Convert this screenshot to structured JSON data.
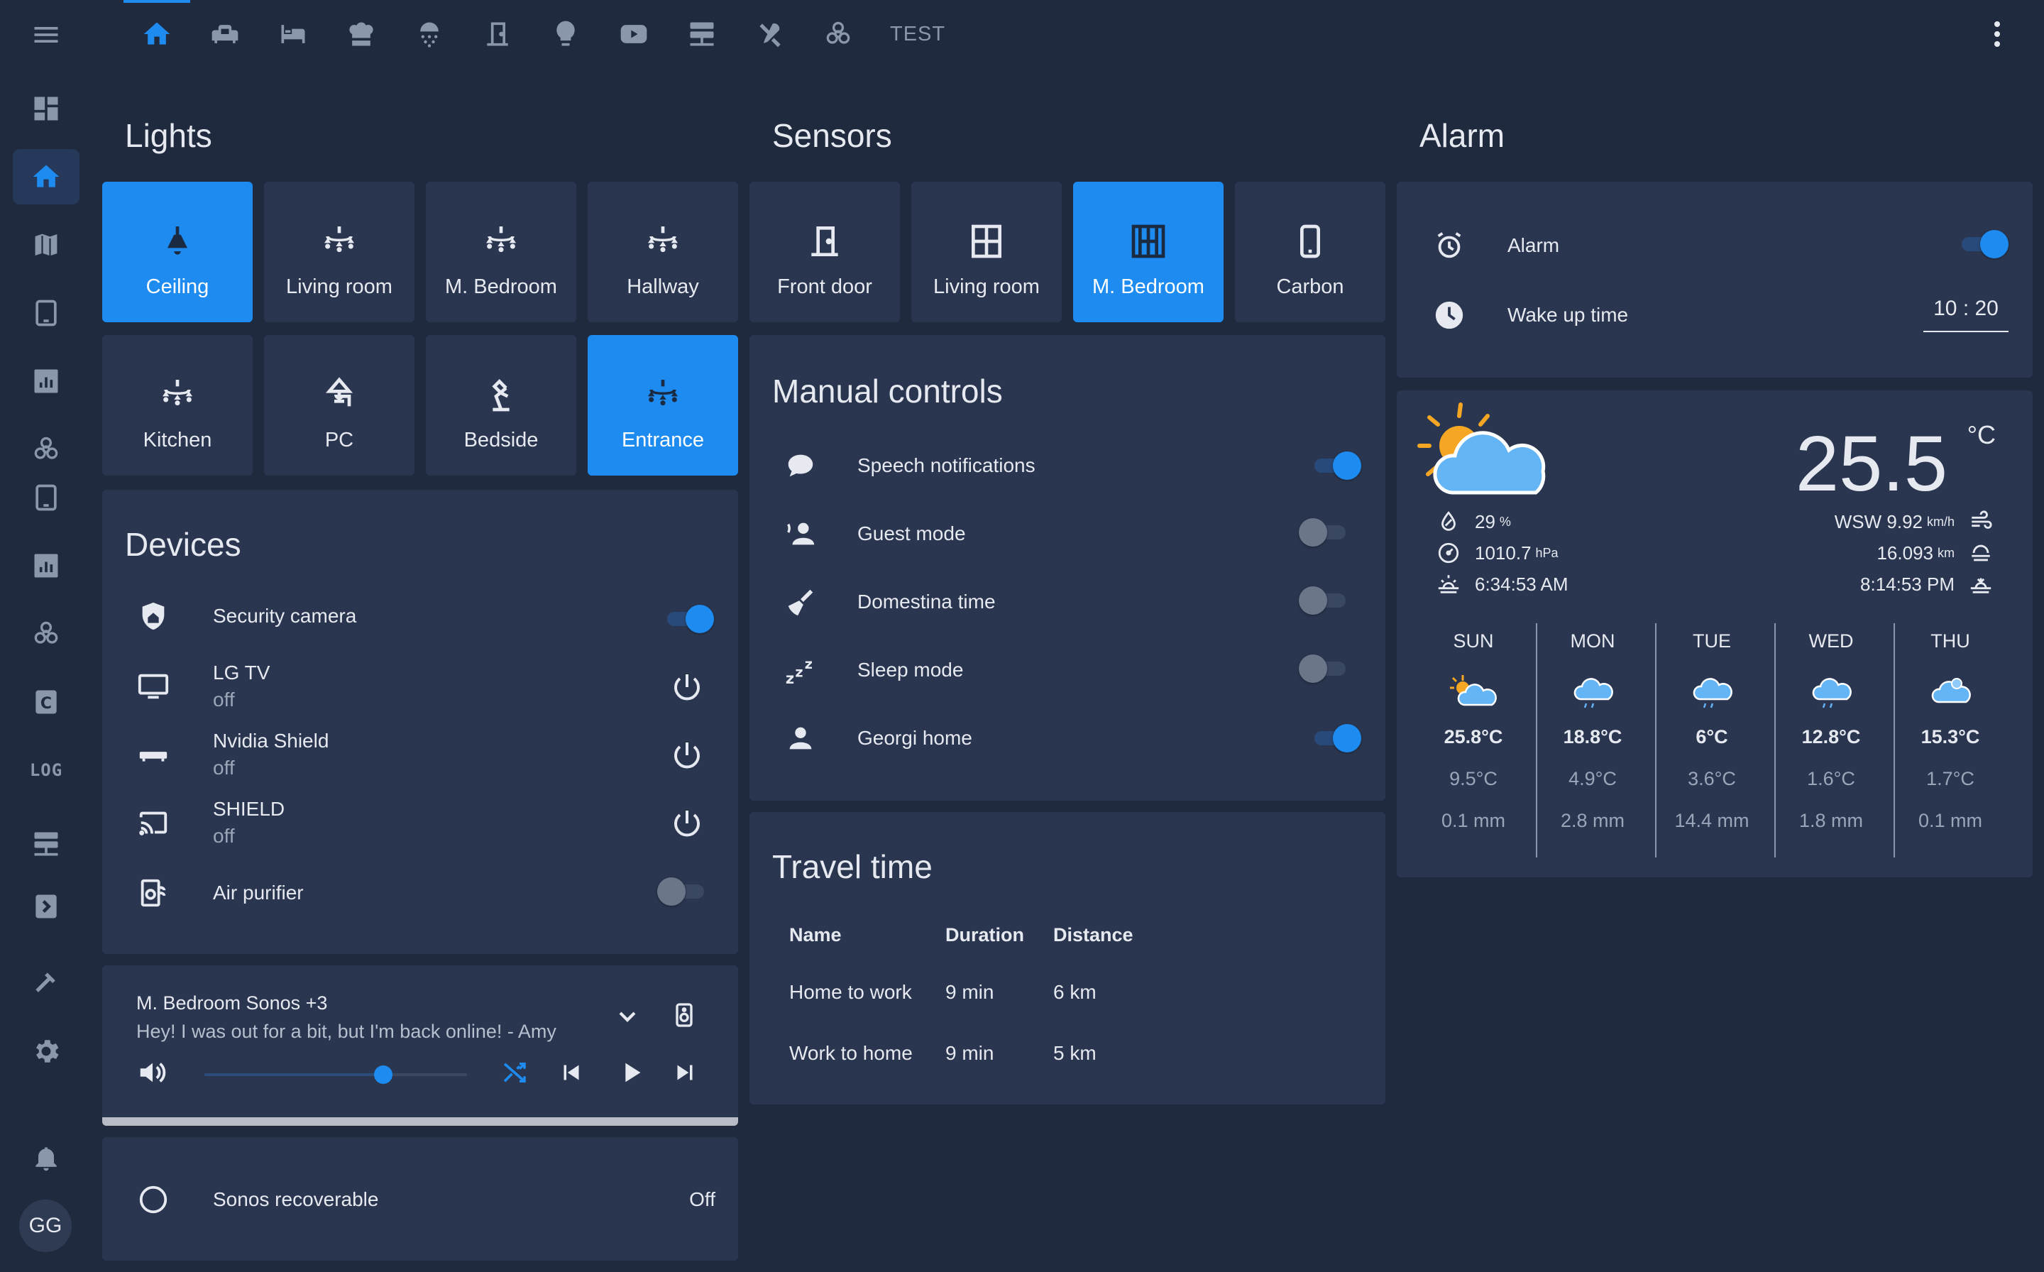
{
  "topbar": {
    "tabs": [
      {
        "icon": "home-icon",
        "active": true
      },
      {
        "icon": "sofa-icon"
      },
      {
        "icon": "bed-icon"
      },
      {
        "icon": "chef-hat-icon"
      },
      {
        "icon": "shower-icon"
      },
      {
        "icon": "door-icon"
      },
      {
        "icon": "lightbulb-icon"
      },
      {
        "icon": "youtube-icon"
      },
      {
        "icon": "server-icon"
      },
      {
        "icon": "tools-icon"
      },
      {
        "icon": "biohazard-icon"
      }
    ],
    "test_label": "TEST"
  },
  "sidebar": {
    "log_label": "LOG",
    "c_label": "C",
    "avatar_initials": "GG"
  },
  "lights": {
    "title": "Lights",
    "tiles": [
      {
        "label": "Ceiling",
        "on": true
      },
      {
        "label": "Living room",
        "on": false
      },
      {
        "label": "M. Bedroom",
        "on": false
      },
      {
        "label": "Hallway",
        "on": false
      },
      {
        "label": "Kitchen",
        "on": false
      },
      {
        "label": "PC",
        "on": false
      },
      {
        "label": "Bedside",
        "on": false
      },
      {
        "label": "Entrance",
        "on": true
      }
    ]
  },
  "sensors": {
    "title": "Sensors",
    "tiles": [
      {
        "label": "Front door",
        "on": false
      },
      {
        "label": "Living room",
        "on": false
      },
      {
        "label": "M. Bedroom",
        "on": true
      },
      {
        "label": "Carbon",
        "on": false
      }
    ]
  },
  "alarm": {
    "title": "Alarm",
    "alarm_label": "Alarm",
    "alarm_on": true,
    "wake_label": "Wake up time",
    "wake_time": "10 : 20"
  },
  "devices": {
    "title": "Devices",
    "items": [
      {
        "label": "Security camera",
        "state": "",
        "control": "toggle-on"
      },
      {
        "label": "LG TV",
        "state": "off",
        "control": "power"
      },
      {
        "label": "Nvidia Shield",
        "state": "off",
        "control": "power"
      },
      {
        "label": "SHIELD",
        "state": "off",
        "control": "power"
      },
      {
        "label": "Air purifier",
        "state": "",
        "control": "toggle-off"
      }
    ]
  },
  "manual": {
    "title": "Manual controls",
    "items": [
      {
        "label": "Speech notifications",
        "on": true
      },
      {
        "label": "Guest mode",
        "on": false
      },
      {
        "label": "Domestina time",
        "on": false
      },
      {
        "label": "Sleep mode",
        "on": false
      },
      {
        "label": "Georgi home",
        "on": true
      }
    ]
  },
  "weather": {
    "temp": "25.5",
    "unit": "°C",
    "humidity": "29",
    "humidity_unit": "%",
    "pressure": "1010.7",
    "pressure_unit": "hPa",
    "sunrise": "6:34:53 AM",
    "wind": "WSW 9.92",
    "wind_unit": "km/h",
    "visibility": "16.093",
    "visibility_unit": "km",
    "sunset": "8:14:53 PM",
    "forecast": [
      {
        "day": "SUN",
        "hi": "25.8°C",
        "lo": "9.5°C",
        "prec": "0.1 mm"
      },
      {
        "day": "MON",
        "hi": "18.8°C",
        "lo": "4.9°C",
        "prec": "2.8 mm"
      },
      {
        "day": "TUE",
        "hi": "6°C",
        "lo": "3.6°C",
        "prec": "14.4 mm"
      },
      {
        "day": "WED",
        "hi": "12.8°C",
        "lo": "1.6°C",
        "prec": "1.8 mm"
      },
      {
        "day": "THU",
        "hi": "15.3°C",
        "lo": "1.7°C",
        "prec": "0.1 mm"
      }
    ]
  },
  "media": {
    "title": "M. Bedroom Sonos +3",
    "subtitle": "Hey! I was out for a bit, but I'm back online! - Amy",
    "volume": 0.68
  },
  "travel": {
    "title": "Travel time",
    "headers": [
      "Name",
      "Duration",
      "Distance"
    ],
    "rows": [
      [
        "Home to work",
        "9 min",
        "6 km"
      ],
      [
        "Work to home",
        "9 min",
        "5 km"
      ]
    ]
  },
  "sonos_recoverable": {
    "label": "Sonos recoverable",
    "state": "Off"
  },
  "colors": {
    "background": "#1f2a3e",
    "card": "#2a3650",
    "accent": "#1e8bf0"
  }
}
